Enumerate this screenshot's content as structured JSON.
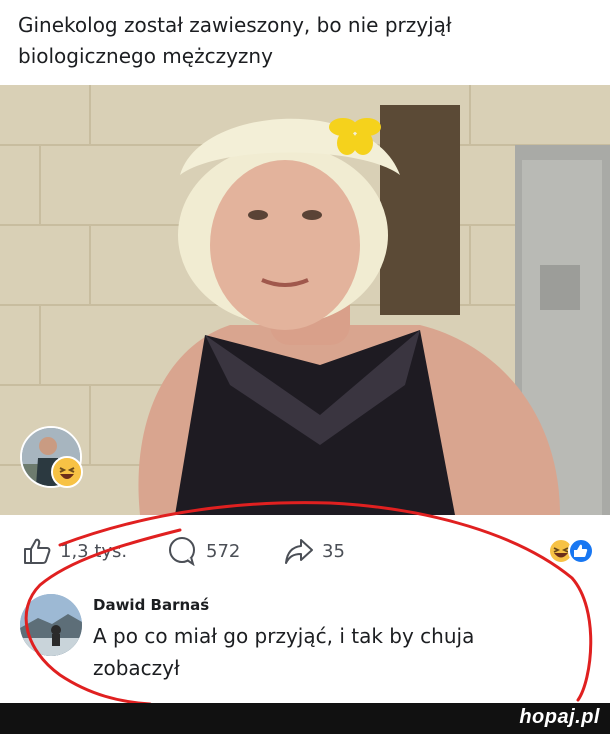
{
  "post": {
    "headline": "Ginekolog został zawieszony, bo nie przyjął biologicznego mężczyzny"
  },
  "actions": {
    "likes_count": "1,3 tys.",
    "comments_count": "572",
    "shares_count": "35"
  },
  "comment": {
    "author": "Dawid Barnaś",
    "text": "A po co miał go przyjąć, i tak by chuja zobaczył"
  },
  "footer": {
    "watermark": "hopaj.pl"
  },
  "icons": [
    "like-icon",
    "comment-icon",
    "share-icon",
    "haha-reaction-icon",
    "like-reaction-icon"
  ],
  "colors": {
    "annotation_red": "#e02020",
    "facebook_blue": "#1877f2",
    "reaction_yellow": "#f7c245"
  }
}
